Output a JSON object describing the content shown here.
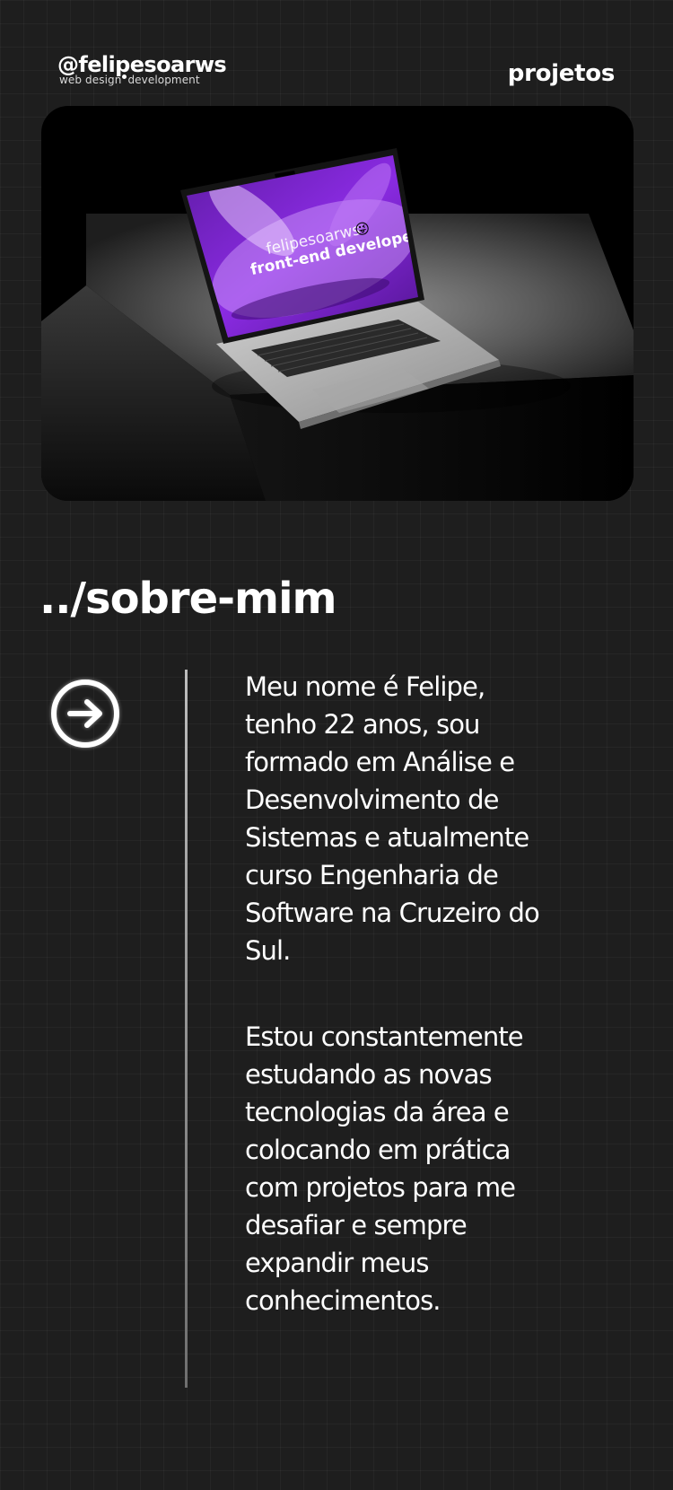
{
  "header": {
    "logo_handle": "@felipesoarws",
    "logo_tagline_left": "web design",
    "logo_tagline_right": "development",
    "nav_projects": "projetos"
  },
  "hero": {
    "screen_line1": "felipesoarws",
    "screen_emoji": "😜",
    "screen_line2": "front-end developer",
    "accent_color": "#8a2be2"
  },
  "about": {
    "title": "../sobre-mim",
    "arrow_icon": "arrow-right-circle-icon",
    "paragraphs": [
      [
        "Meu nome é Felipe,",
        "tenho 22 anos, sou",
        "formado em Análise e",
        "Desenvolvimento de",
        "Sistemas e atualmente",
        "curso Engenharia de",
        "Software na Cruzeiro do",
        "Sul."
      ],
      [
        "Estou constantemente",
        "estudando as novas",
        "tecnologias da área e",
        "colocando em prática",
        "com projetos para me",
        "desafiar e sempre",
        "expandir meus",
        "conhecimentos."
      ]
    ]
  },
  "theme": {
    "background": "#1e1e1e",
    "text": "#ffffff",
    "divider": "#9a9a9a"
  }
}
